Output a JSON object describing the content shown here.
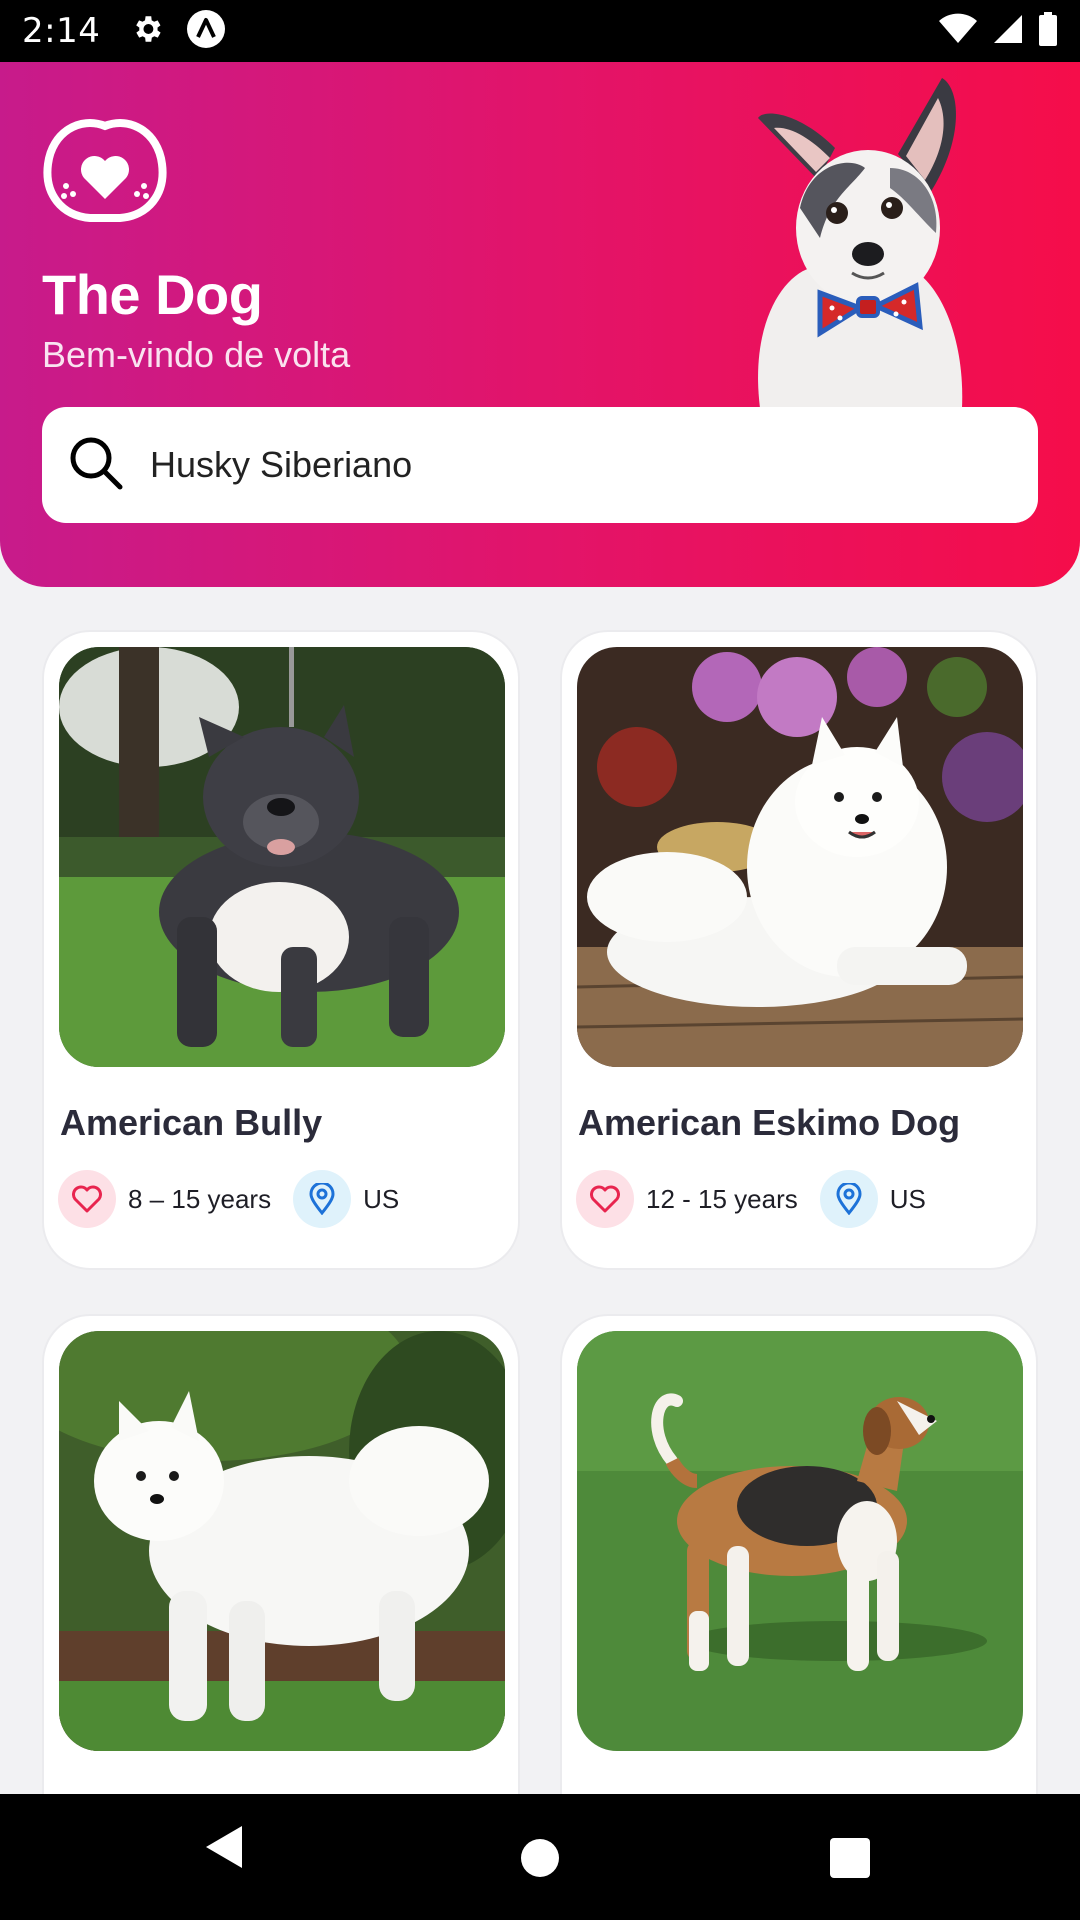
{
  "status_bar": {
    "time": "2:14",
    "icons": [
      "gear-icon",
      "app-badge-icon",
      "wifi-icon",
      "signal-icon",
      "battery-icon"
    ]
  },
  "header": {
    "title": "The Dog",
    "subtitle": "Bem-vindo de volta",
    "search": {
      "value": "Husky Siberiano",
      "icon": "search-icon"
    },
    "colors": {
      "gradient_start": "#c71b8b",
      "gradient_end": "#f50d4a"
    }
  },
  "breeds": [
    {
      "name": "American Bully",
      "life_span": "8 – 15 years",
      "origin": "US"
    },
    {
      "name": "American Eskimo Dog",
      "life_span": "12 - 15 years",
      "origin": "US"
    },
    {
      "name": "",
      "life_span": "",
      "origin": ""
    },
    {
      "name": "",
      "life_span": "",
      "origin": ""
    }
  ],
  "nav_bar": {
    "buttons": [
      "back-icon",
      "home-icon",
      "recents-icon"
    ]
  }
}
